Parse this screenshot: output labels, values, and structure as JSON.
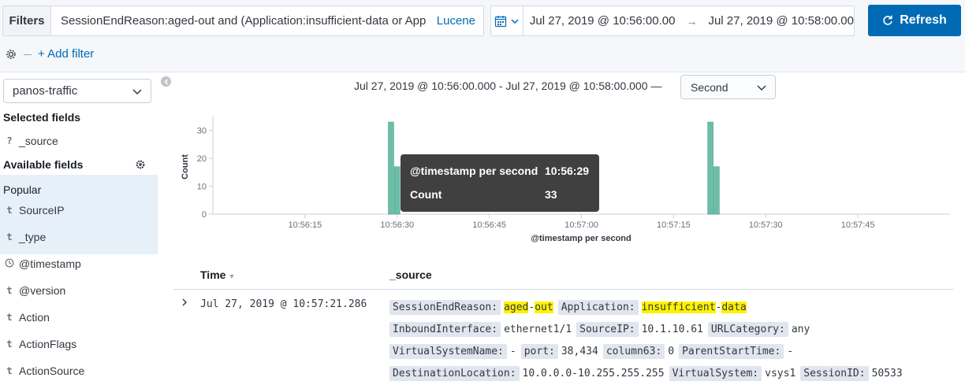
{
  "query_bar": {
    "filters_label": "Filters",
    "query": "SessionEndReason:aged-out and (Application:insufficient-data or App",
    "language": "Lucene"
  },
  "time_picker": {
    "start": "Jul 27, 2019 @ 10:56:00.00",
    "arrow": "→",
    "end": "Jul 27, 2019 @ 10:58:00.00",
    "icon": "calendar-icon"
  },
  "refresh_label": "Refresh",
  "add_filter": "+ Add filter",
  "sidebar": {
    "index_pattern": "panos-traffic",
    "selected_title": "Selected fields",
    "selected_fields": [
      {
        "type": "?",
        "name": "_source"
      }
    ],
    "available_title": "Available fields",
    "popular_title": "Popular",
    "popular_fields": [
      {
        "type": "t",
        "name": "SourceIP"
      },
      {
        "type": "t",
        "name": "_type"
      }
    ],
    "fields": [
      {
        "type": "clock",
        "name": "@timestamp"
      },
      {
        "type": "t",
        "name": "@version"
      },
      {
        "type": "t",
        "name": "Action"
      },
      {
        "type": "t",
        "name": "ActionFlags"
      },
      {
        "type": "t",
        "name": "ActionSource"
      }
    ]
  },
  "histogram": {
    "range_label": "Jul 27, 2019 @ 10:56:00.000 - Jul 27, 2019 @ 10:58:00.000 —",
    "interval": "Second"
  },
  "chart_data": {
    "type": "bar",
    "xlabel": "@timestamp per second",
    "ylabel": "Count",
    "ylim": [
      0,
      35
    ],
    "yticks": [
      0,
      10,
      20,
      30
    ],
    "x_range_seconds": [
      "10:56:00",
      "10:58:00"
    ],
    "xticks": [
      "10:56:15",
      "10:56:30",
      "10:56:45",
      "10:57:00",
      "10:57:15",
      "10:57:30",
      "10:57:45"
    ],
    "bars": [
      {
        "x": "10:56:29",
        "value": 33
      },
      {
        "x": "10:56:30",
        "value": 17
      },
      {
        "x": "10:57:21",
        "value": 33
      },
      {
        "x": "10:57:22",
        "value": 17
      }
    ],
    "color": "#54b399",
    "grid": false
  },
  "tooltip": {
    "key1": "@timestamp per second",
    "val1": "10:56:29",
    "key2": "Count",
    "val2": "33"
  },
  "table": {
    "col_time": "Time",
    "col_source": "_source",
    "rows": [
      {
        "time": "Jul 27, 2019 @ 10:57:21.286",
        "source_lines": [
          [
            {
              "k": "SessionEndReason:",
              "v": [
                [
                  "aged",
                  true
                ],
                [
                  "-",
                  false
                ],
                [
                  "out",
                  true
                ]
              ]
            },
            {
              "k": "Application:",
              "v": [
                [
                  "insufficient",
                  true
                ],
                [
                  "-",
                  false
                ],
                [
                  "data",
                  true
                ]
              ]
            }
          ],
          [
            {
              "k": "InboundInterface:",
              "v": [
                [
                  "ethernet1/1",
                  false
                ]
              ]
            },
            {
              "k": "SourceIP:",
              "v": [
                [
                  "10.1.10.61",
                  false
                ]
              ]
            },
            {
              "k": "URLCategory:",
              "v": [
                [
                  "any",
                  false
                ]
              ]
            }
          ],
          [
            {
              "k": "VirtualSystemName:",
              "v": [
                [
                  "-",
                  false
                ]
              ]
            },
            {
              "k": "port:",
              "v": [
                [
                  "38,434",
                  false
                ]
              ]
            },
            {
              "k": "column63:",
              "v": [
                [
                  "0",
                  false
                ]
              ]
            },
            {
              "k": "ParentStartTime:",
              "v": [
                [
                  "-",
                  false
                ]
              ]
            }
          ],
          [
            {
              "k": "DestinationLocation:",
              "v": [
                [
                  "10.0.0.0-10.255.255.255",
                  false
                ]
              ]
            },
            {
              "k": "VirtualSystem:",
              "v": [
                [
                  "vsys1",
                  false
                ]
              ]
            },
            {
              "k": "SessionID:",
              "v": [
                [
                  "50533",
                  false
                ]
              ]
            }
          ]
        ]
      }
    ]
  }
}
